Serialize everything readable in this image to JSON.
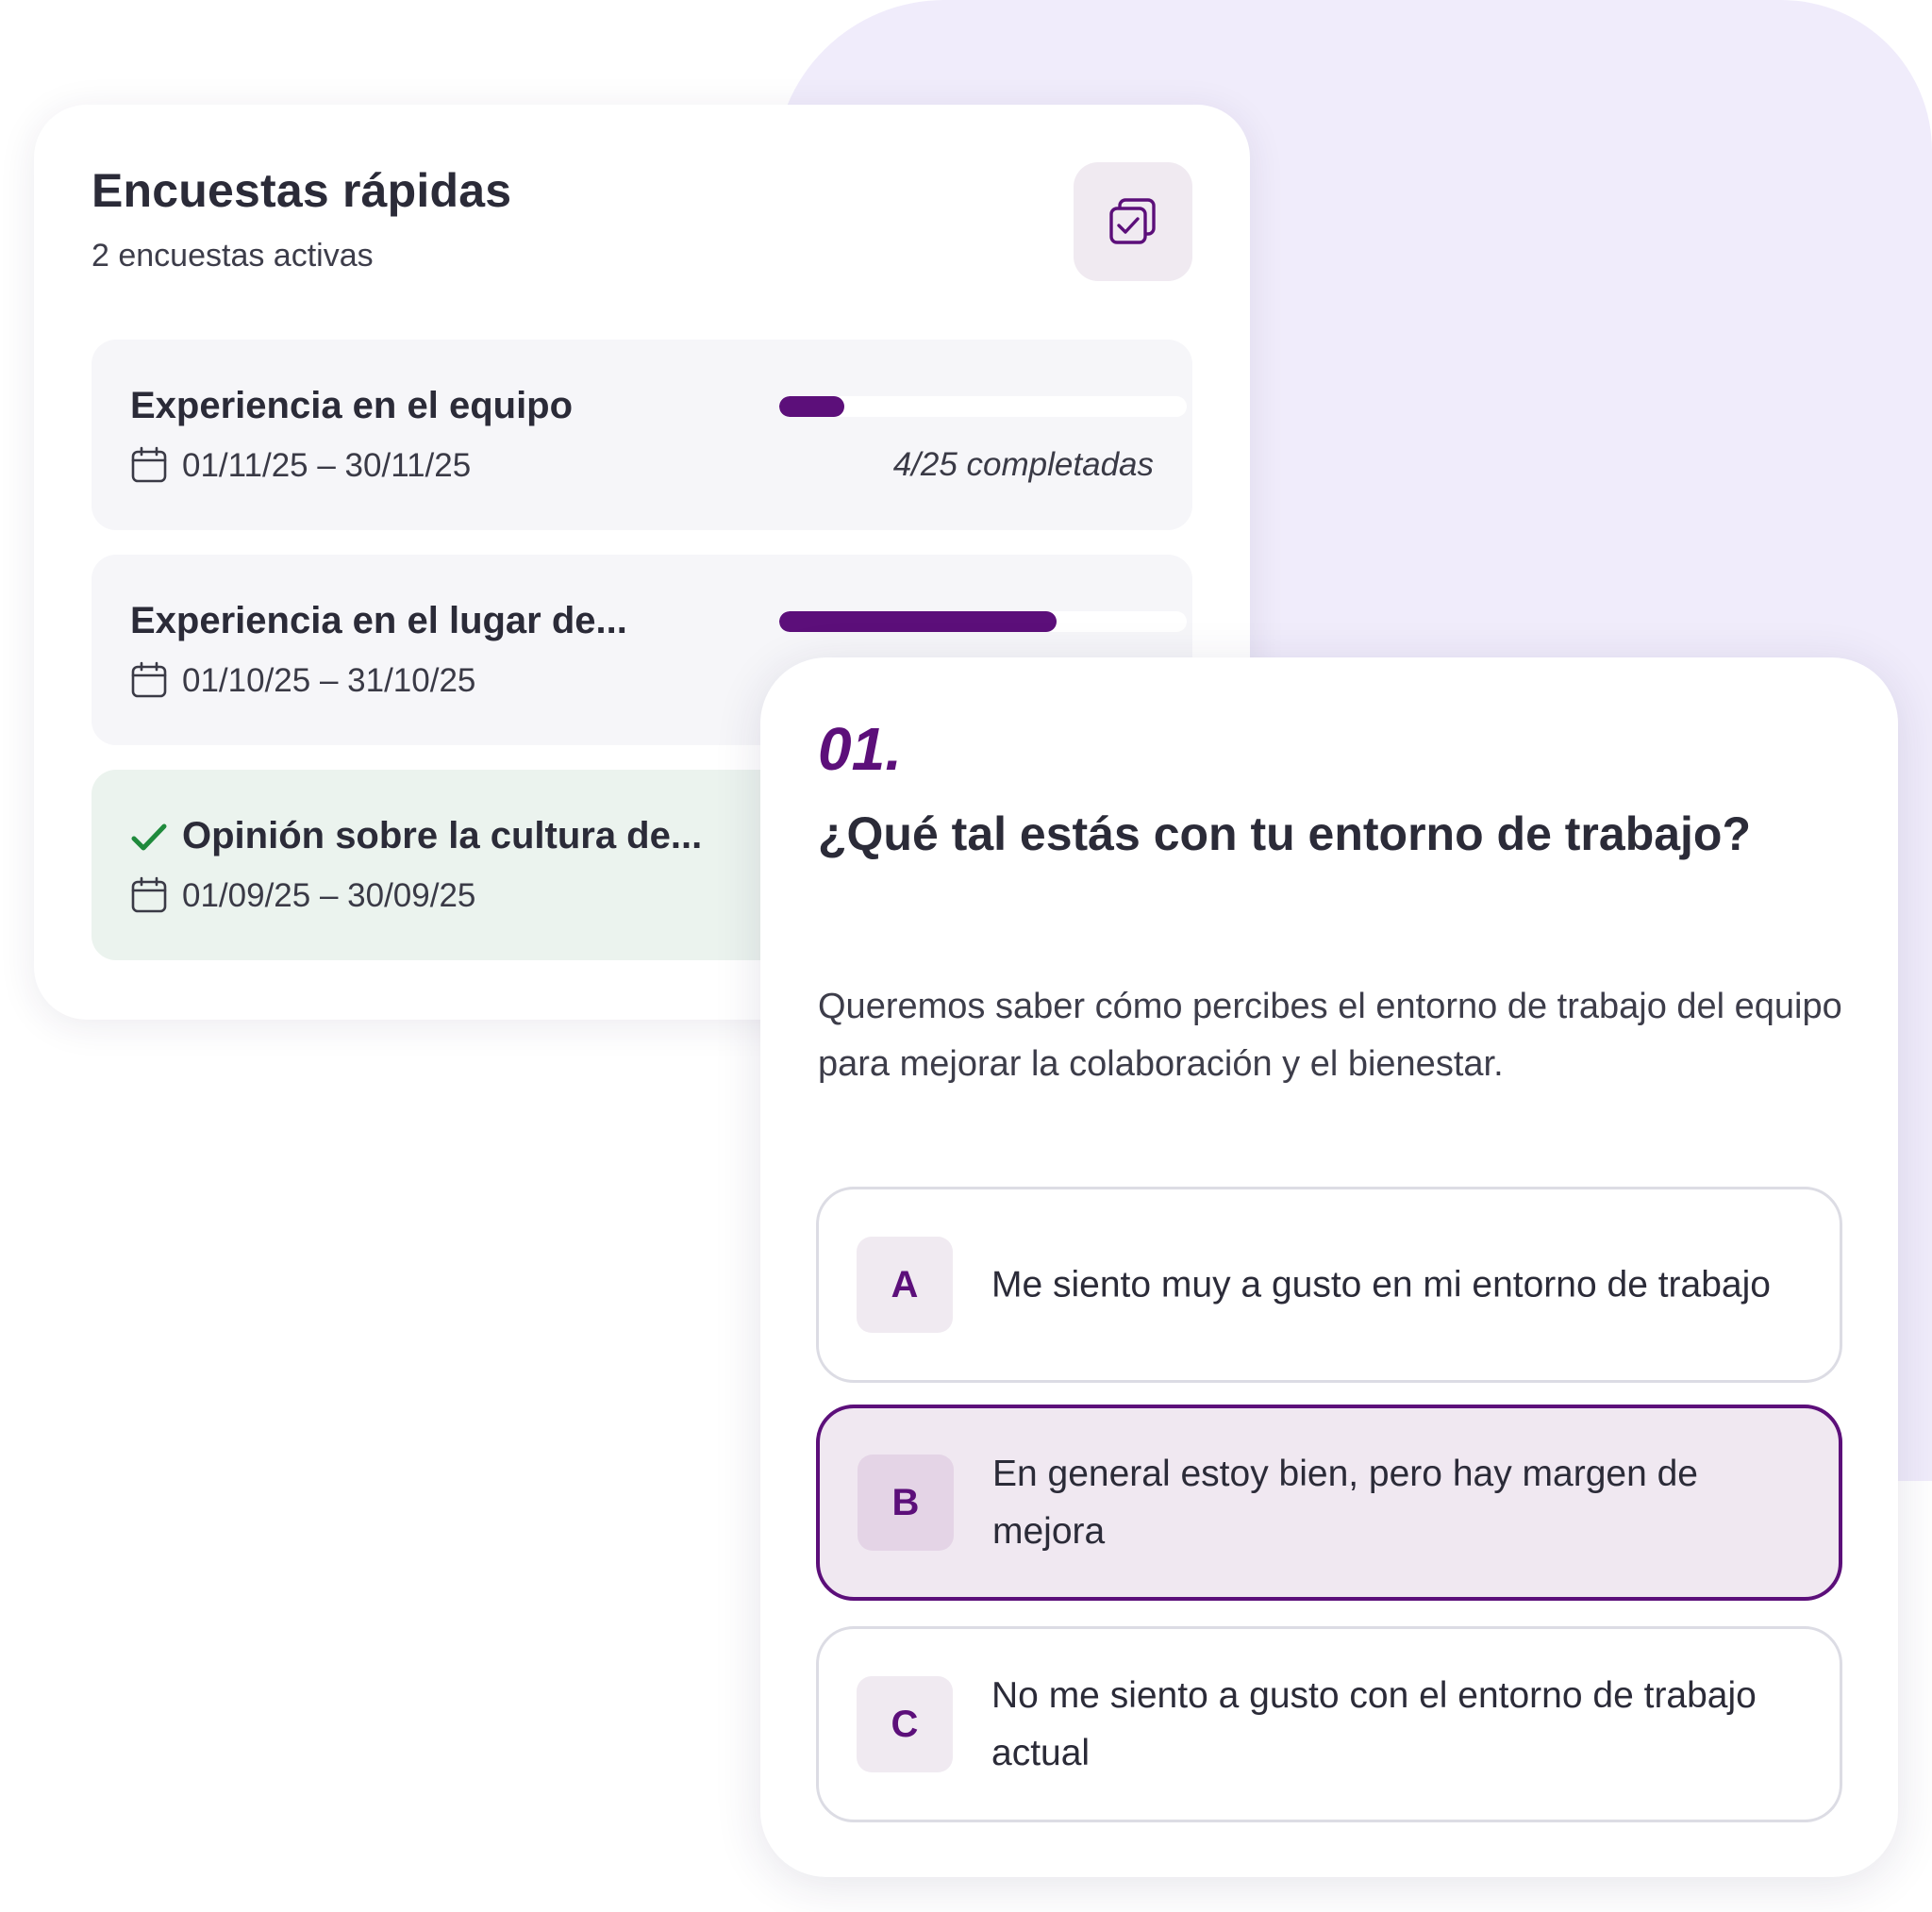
{
  "colors": {
    "accent": "#5c0f7a",
    "background_blob": "#f0ecfb",
    "completed_row": "#ebf3ee",
    "check_green": "#1f8a3c"
  },
  "surveys_card": {
    "title": "Encuestas rápidas",
    "subtitle": "2 encuestas activas",
    "action_icon": "checkbox-stack-icon",
    "items": [
      {
        "name": "Experiencia en el equipo",
        "dates": "01/11/25 – 30/11/25",
        "progress": 0.16,
        "progress_text": "4/25 completadas",
        "completed": false
      },
      {
        "name": "Experiencia en el lugar de...",
        "dates": "01/10/25 – 31/10/25",
        "progress": 0.68,
        "completed": false
      },
      {
        "name": "Opinión sobre la cultura de...",
        "dates": "01/09/25 – 30/09/25",
        "completed": true
      }
    ]
  },
  "question_card": {
    "number": "01.",
    "title": "¿Qué tal estás con tu entorno de trabajo?",
    "description": "Queremos saber cómo percibes el entorno de trabajo del equipo para mejorar la colaboración y el bienestar.",
    "selected_option": "B",
    "options": [
      {
        "letter": "A",
        "text": "Me siento muy a gusto en mi entorno de trabajo"
      },
      {
        "letter": "B",
        "text": "En general estoy bien, pero hay margen de mejora"
      },
      {
        "letter": "C",
        "text": "No me siento a gusto con el entorno de trabajo actual"
      }
    ]
  }
}
